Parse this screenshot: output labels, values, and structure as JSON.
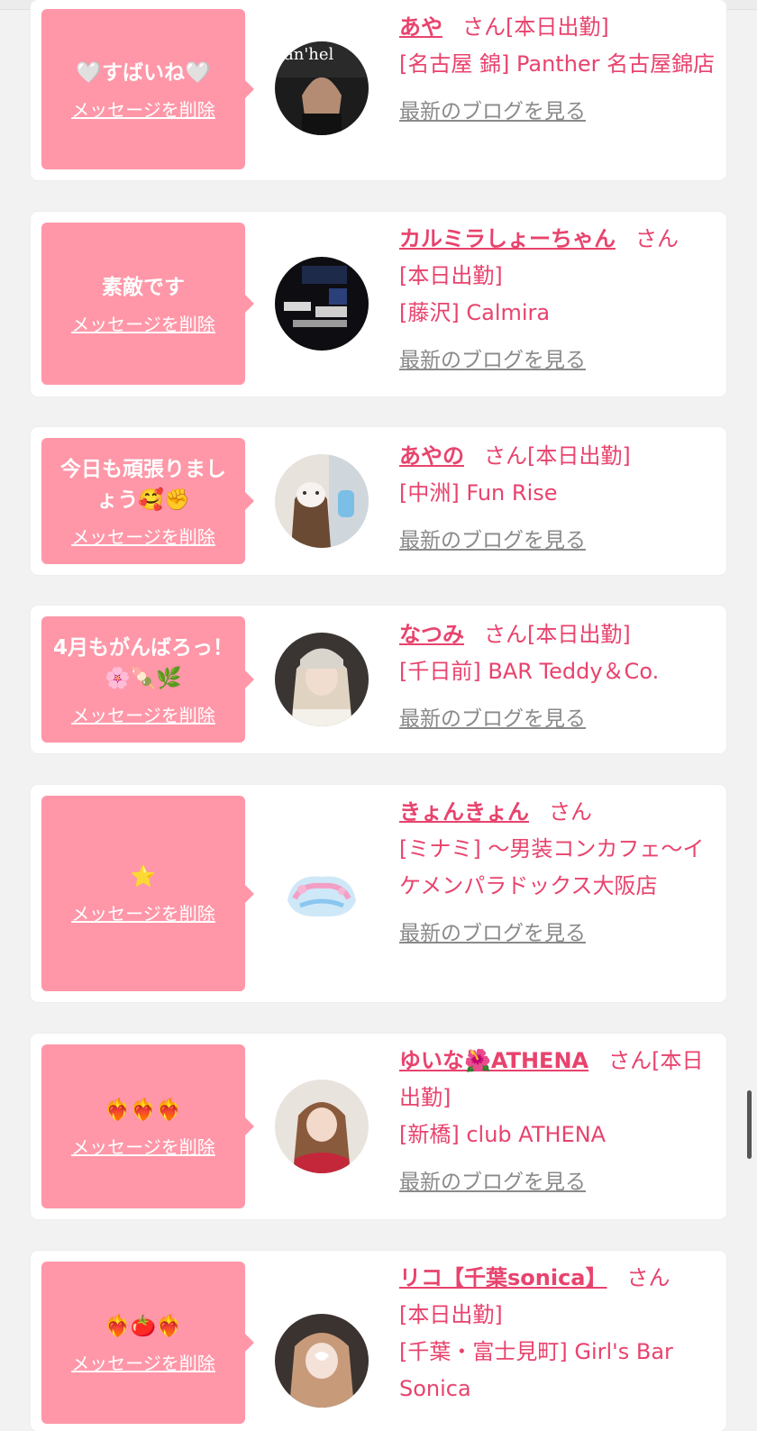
{
  "entries": [
    {
      "message": "🤍すばいね🤍",
      "delete_label": "メッセージを削除",
      "name": "あや",
      "san": "さん",
      "status": "[本日出勤]",
      "shop": "[名古屋 錦] Panther 名古屋錦店",
      "blog": "最新のブログを見る"
    },
    {
      "message": "素敵です",
      "delete_label": "メッセージを削除",
      "name": "カルミラしょーちゃん",
      "san": "さん",
      "status": "[本日出勤]",
      "shop": "[藤沢] Calmira",
      "blog": "最新のブログを見る"
    },
    {
      "message": "今日も頑張りましょう🥰✊",
      "delete_label": "メッセージを削除",
      "name": "あやの",
      "san": "さん",
      "status": "[本日出勤]",
      "shop": "[中洲] Fun Rise",
      "blog": "最新のブログを見る"
    },
    {
      "message": "4月もがんばろっ！🌸🍡🌿",
      "delete_label": "メッセージを削除",
      "name": "なつみ",
      "san": "さん",
      "status": "[本日出勤]",
      "shop": "[千日前] BAR Teddy＆Co.",
      "blog": "最新のブログを見る"
    },
    {
      "message": "⭐",
      "delete_label": "メッセージを削除",
      "name": "きょんきょん",
      "san": "さん",
      "status": "",
      "shop": "[ミナミ] 〜男装コンカフェ〜イケメンパラドックス大阪店",
      "blog": "最新のブログを見る"
    },
    {
      "message": "❤️‍🔥❤️‍🔥❤️‍🔥",
      "delete_label": "メッセージを削除",
      "name": "ゆいな🌺ATHENA",
      "san": "さん",
      "status": "[本日出勤]",
      "shop": "[新橋] club ATHENA",
      "blog": "最新のブログを見る"
    },
    {
      "message": "❤️‍🔥🍅❤️‍🔥",
      "delete_label": "メッセージを削除",
      "name": "リコ【千葉sonica】",
      "san": "さん",
      "status": "[本日出勤]",
      "shop": "[千葉・富士見町] Girl's Bar Sonica",
      "blog": ""
    }
  ],
  "colors": {
    "accent": "#e8436d",
    "bubble": "#ff97a8",
    "link_gray": "#8a8a8a",
    "background": "#f2f2f2"
  }
}
